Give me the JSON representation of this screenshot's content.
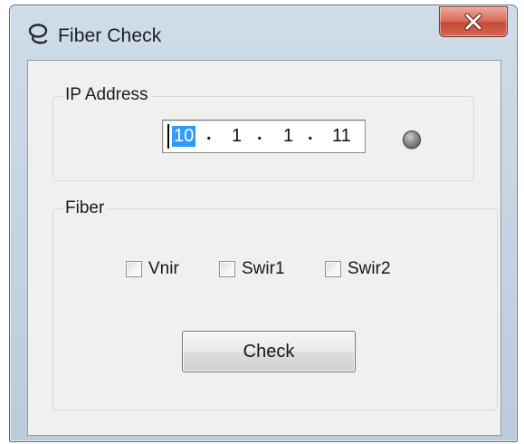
{
  "window": {
    "title": "Fiber Check",
    "icon": "fiber-loop-icon",
    "close_icon": "close-x-icon"
  },
  "ip_group": {
    "label": "IP Address",
    "octets": [
      "10",
      "1",
      "1",
      "11"
    ],
    "separator": ".",
    "status_led": "gray"
  },
  "fiber_group": {
    "label": "Fiber",
    "checkboxes": [
      {
        "label": "Vnir",
        "checked": false
      },
      {
        "label": "Swir1",
        "checked": false
      },
      {
        "label": "Swir2",
        "checked": false
      }
    ]
  },
  "actions": {
    "check_label": "Check"
  },
  "colors": {
    "selection": "#3399ff",
    "close_button": "#c9503d",
    "dialog_bg": "#f0f0f0"
  }
}
